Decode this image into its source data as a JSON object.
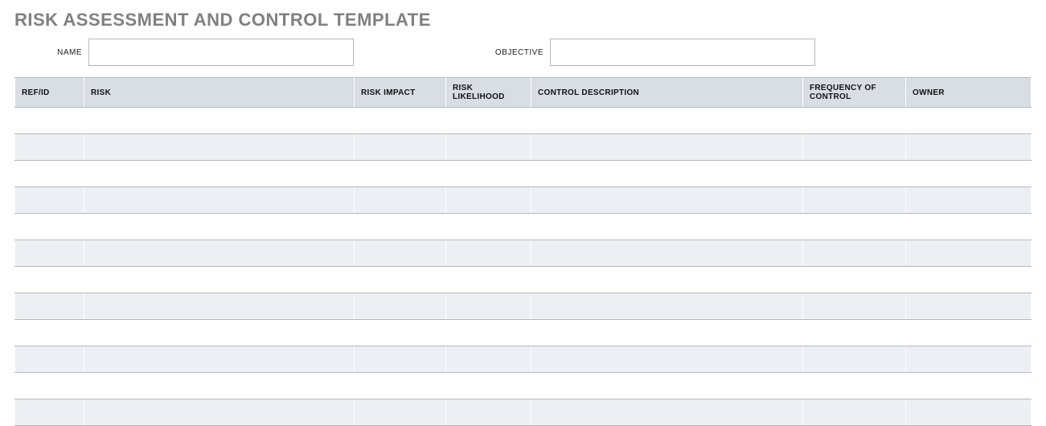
{
  "title": "RISK ASSESSMENT AND CONTROL TEMPLATE",
  "meta": {
    "name_label": "NAME",
    "name_value": "",
    "objective_label": "OBJECTIVE",
    "objective_value": ""
  },
  "columns": {
    "ref": "REF/ID",
    "risk": "RISK",
    "impact": "RISK IMPACT",
    "likelihood": "RISK LIKELIHOOD",
    "control": "CONTROL DESCRIPTION",
    "frequency": "FREQUENCY OF CONTROL",
    "owner": "OWNER"
  },
  "rows": [
    {
      "ref": "",
      "risk": "",
      "impact": "",
      "likelihood": "",
      "control": "",
      "frequency": "",
      "owner": ""
    },
    {
      "ref": "",
      "risk": "",
      "impact": "",
      "likelihood": "",
      "control": "",
      "frequency": "",
      "owner": ""
    },
    {
      "ref": "",
      "risk": "",
      "impact": "",
      "likelihood": "",
      "control": "",
      "frequency": "",
      "owner": ""
    },
    {
      "ref": "",
      "risk": "",
      "impact": "",
      "likelihood": "",
      "control": "",
      "frequency": "",
      "owner": ""
    },
    {
      "ref": "",
      "risk": "",
      "impact": "",
      "likelihood": "",
      "control": "",
      "frequency": "",
      "owner": ""
    },
    {
      "ref": "",
      "risk": "",
      "impact": "",
      "likelihood": "",
      "control": "",
      "frequency": "",
      "owner": ""
    },
    {
      "ref": "",
      "risk": "",
      "impact": "",
      "likelihood": "",
      "control": "",
      "frequency": "",
      "owner": ""
    },
    {
      "ref": "",
      "risk": "",
      "impact": "",
      "likelihood": "",
      "control": "",
      "frequency": "",
      "owner": ""
    },
    {
      "ref": "",
      "risk": "",
      "impact": "",
      "likelihood": "",
      "control": "",
      "frequency": "",
      "owner": ""
    },
    {
      "ref": "",
      "risk": "",
      "impact": "",
      "likelihood": "",
      "control": "",
      "frequency": "",
      "owner": ""
    },
    {
      "ref": "",
      "risk": "",
      "impact": "",
      "likelihood": "",
      "control": "",
      "frequency": "",
      "owner": ""
    },
    {
      "ref": "",
      "risk": "",
      "impact": "",
      "likelihood": "",
      "control": "",
      "frequency": "",
      "owner": ""
    }
  ]
}
